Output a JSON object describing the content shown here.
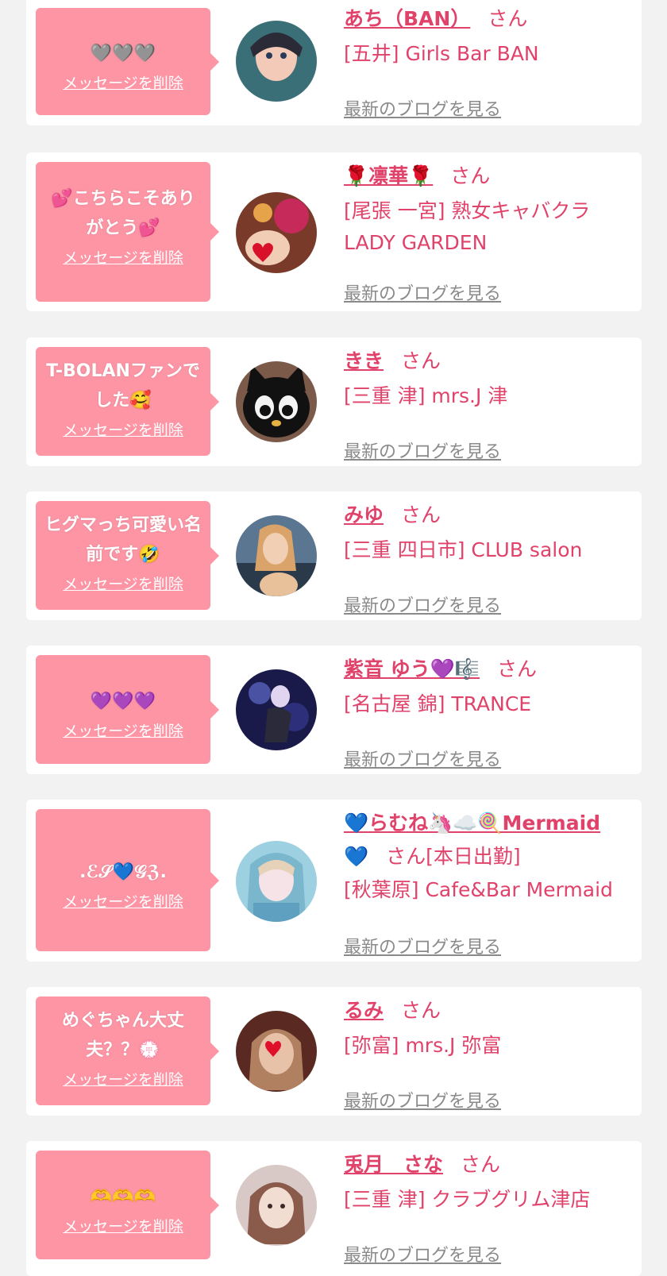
{
  "cards": [
    {
      "message": "🩶🩶🩶",
      "delete_label": "メッセージを削除",
      "name": "あち（BAN）",
      "honorific": "さん",
      "shop_line1": "[五井] Girls Bar BAN",
      "shop_line2": "",
      "blog_label": "最新のブログを見る",
      "colors": {
        "avatar_bg": "#3b6f78",
        "avatar_fg": "#f3c9b7"
      }
    },
    {
      "message": "💕こちらこそありがとう💕",
      "delete_label": "メッセージを削除",
      "name": "🌹凛華🌹",
      "honorific": "さん",
      "shop_line1": "[尾張 一宮] 熟女キャバクラ",
      "shop_line2": "LADY GARDEN",
      "blog_label": "最新のブログを見る",
      "colors": {
        "avatar_bg": "#7a3a2a",
        "avatar_fg": "#d8406a"
      }
    },
    {
      "message": "T-BOLANファンでした🥰",
      "delete_label": "メッセージを削除",
      "name": "きき",
      "honorific": "さん",
      "shop_line1": "[三重 津] mrs.J 津",
      "shop_line2": "",
      "blog_label": "最新のブログを見る",
      "colors": {
        "avatar_bg": "#111111",
        "avatar_fg": "#f4f4f4"
      }
    },
    {
      "message": "ヒグマっち可愛い名前です🤣",
      "delete_label": "メッセージを削除",
      "name": "みゆ",
      "honorific": "さん",
      "shop_line1": "[三重 四日市] CLUB salon",
      "shop_line2": "",
      "blog_label": "最新のブログを見る",
      "colors": {
        "avatar_bg": "#5a7690",
        "avatar_fg": "#e8c09a"
      }
    },
    {
      "message": "💜💜💜",
      "delete_label": "メッセージを削除",
      "name": "紫音 ゆう💜🎼",
      "honorific": "さん",
      "shop_line1": "[名古屋 錦] TRANCE",
      "shop_line2": "",
      "blog_label": "最新のブログを見る",
      "colors": {
        "avatar_bg": "#1a1a4a",
        "avatar_fg": "#6b7adf"
      }
    },
    {
      "message": ".ℰ𝒮💙𝒢ℨ.",
      "delete_label": "メッセージを削除",
      "name": "💙らむね🦄☁️🍭Mermaid",
      "name_cont": "💙",
      "honorific": "さん[本日出勤]",
      "shop_line1": "[秋葉原] Cafe&Bar Mermaid",
      "shop_line2": "",
      "blog_label": "最新のブログを見る",
      "colors": {
        "avatar_bg": "#9dd0e0",
        "avatar_fg": "#f6e3e8"
      }
    },
    {
      "message": "めぐちゃん大丈夫？？💮",
      "delete_label": "メッセージを削除",
      "name": "るみ",
      "honorific": "さん",
      "shop_line1": "[弥富] mrs.J 弥富",
      "shop_line2": "",
      "blog_label": "最新のブログを見る",
      "colors": {
        "avatar_bg": "#5a2a22",
        "avatar_fg": "#e8c2a8"
      }
    },
    {
      "message": "🫶🫶🫶",
      "delete_label": "メッセージを削除",
      "name": "兎月　さな",
      "honorific": "さん",
      "shop_line1": "[三重 津] クラブグリム津店",
      "shop_line2": "",
      "blog_label": "最新のブログを見る",
      "colors": {
        "avatar_bg": "#d9c9c6",
        "avatar_fg": "#f1ddd2"
      }
    }
  ]
}
